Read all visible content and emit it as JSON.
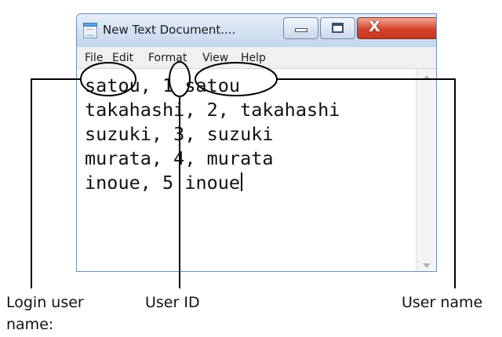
{
  "window": {
    "title": "New Text Document....",
    "close_label": "X"
  },
  "menu": {
    "file": "File",
    "edit": "Edit",
    "format": "Format",
    "view": "View",
    "help": "Help"
  },
  "editor": {
    "lines": [
      "satou, 1 satou",
      "takahashi, 2, takahashi",
      "suzuki, 3, suzuki",
      "murata, 4, murata",
      "inoue, 5 inoue"
    ]
  },
  "annotations": {
    "login_line1": "Login user",
    "login_line2": "name:",
    "user_id": "User ID",
    "user_name": "User name"
  }
}
